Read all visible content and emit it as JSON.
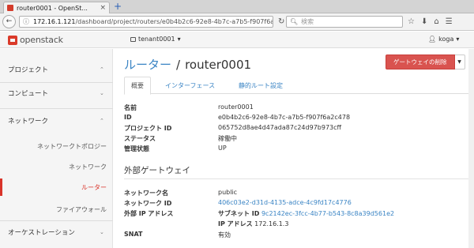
{
  "browser": {
    "tab_title": "router0001 - OpenSt...",
    "tab_close": "×",
    "new_tab": "+",
    "back": "←",
    "url_host": "172.16.1.121",
    "url_path": "/dashboard/project/routers/e0b4b2c6-92e8-4b7c-a7b5-f907f6a2",
    "search_placeholder": "検索",
    "nav_icons": [
      "☆",
      "⬇",
      "⌂",
      "☰"
    ]
  },
  "header": {
    "logo_text": "openstack",
    "tenant": "tenant0001",
    "user": "koga"
  },
  "sidebar": {
    "sections": [
      {
        "label": "プロジェクト",
        "chevron": "⌃"
      },
      {
        "label": "コンピュート",
        "chevron": "⌄"
      },
      {
        "label": "ネットワーク",
        "chevron": "⌃"
      },
      {
        "label": "オーケストレーション",
        "chevron": "⌄"
      }
    ],
    "network_items": [
      {
        "label": "ネットワークトポロジー",
        "active": false
      },
      {
        "label": "ネットワーク",
        "active": false
      },
      {
        "label": "ルーター",
        "active": true
      },
      {
        "label": "ファイアウォール",
        "active": false
      }
    ]
  },
  "main": {
    "breadcrumb_parent": "ルーター",
    "breadcrumb_sep": "/",
    "title": "router0001",
    "delete_gateway_button": "ゲートウェイの削除",
    "tabs": [
      {
        "label": "概要",
        "active": true
      },
      {
        "label": "インターフェース",
        "active": false
      },
      {
        "label": "静的ルート設定",
        "active": false
      }
    ],
    "overview": [
      {
        "label": "名前",
        "value": "router0001"
      },
      {
        "label": "ID",
        "value": "e0b4b2c6-92e8-4b7c-a7b5-f907f6a2c478"
      },
      {
        "label": "プロジェクト ID",
        "value": "065752d8ae4d47ada87c24d97b973cff"
      },
      {
        "label": "ステータス",
        "value": "稼働中"
      },
      {
        "label": "管理状態",
        "value": "UP"
      }
    ],
    "external_gateway_title": "外部ゲートウェイ",
    "gateway": {
      "network_name_label": "ネットワーク名",
      "network_name": "public",
      "network_id_label": "ネットワーク ID",
      "network_id": "406c03e2-d31d-4135-adce-4c9fd17c4776",
      "external_ip_label": "外部 IP アドレス",
      "subnet_id_label": "サブネット ID",
      "subnet_id": "9c2142ec-3fcc-4b77-b543-8c8a39d561e2",
      "ip_address_label": "IP アドレス",
      "ip_address": "172.16.1.3",
      "snat_label": "SNAT",
      "snat_value": "有効"
    }
  }
}
